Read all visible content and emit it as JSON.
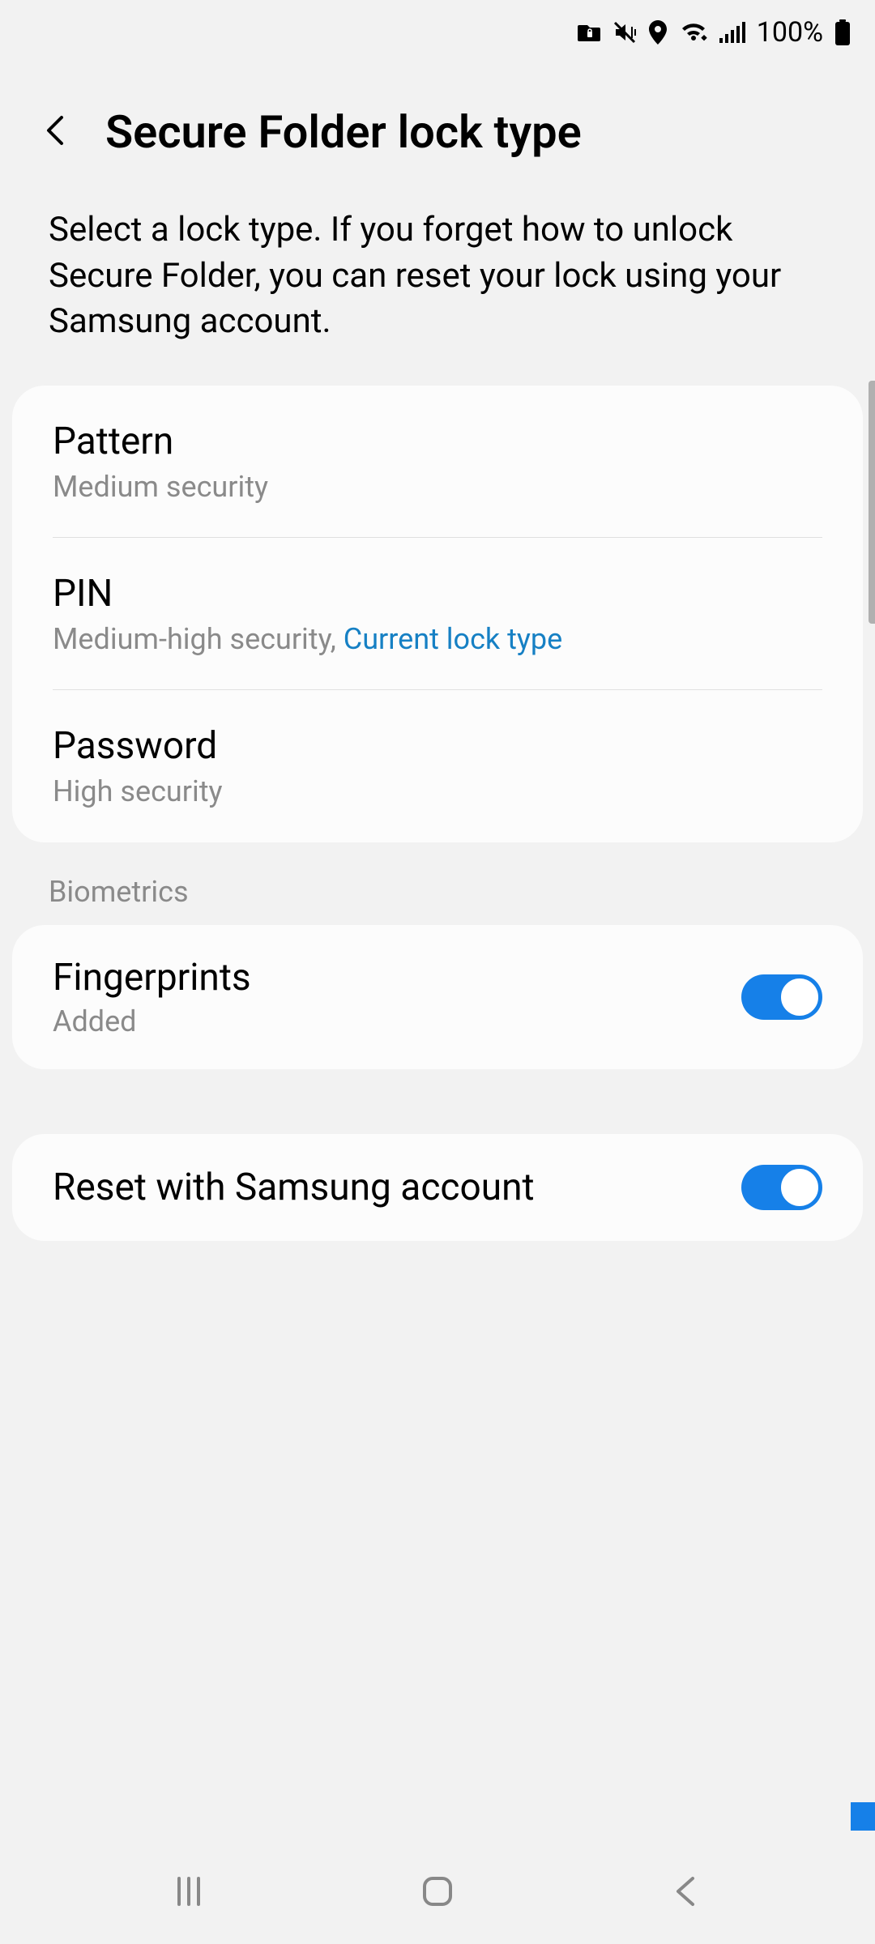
{
  "statusBar": {
    "batteryText": "100%"
  },
  "header": {
    "title": "Secure Folder lock type"
  },
  "description": "Select a lock type. If you forget how to unlock Secure Folder, you can reset your lock using your Samsung account.",
  "lockTypes": [
    {
      "title": "Pattern",
      "subtitle": "Medium security",
      "current": false
    },
    {
      "title": "PIN",
      "subtitle": "Medium-high security, ",
      "currentLabel": "Current lock type",
      "current": true
    },
    {
      "title": "Password",
      "subtitle": "High security",
      "current": false
    }
  ],
  "sections": {
    "biometrics": "Biometrics"
  },
  "biometrics": {
    "fingerprints": {
      "title": "Fingerprints",
      "subtitle": "Added",
      "enabled": true
    }
  },
  "resetOption": {
    "title": "Reset with Samsung account",
    "enabled": true
  }
}
